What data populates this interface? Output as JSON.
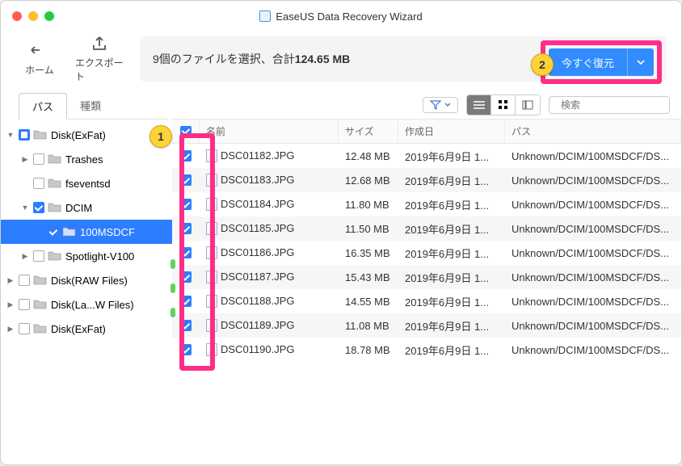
{
  "window_title": "EaseUS Data Recovery Wizard",
  "toolbar": {
    "home": "ホーム",
    "export": "エクスポート"
  },
  "summary": {
    "prefix": "9個のファイルを選択、合計",
    "size": "124.65 MB"
  },
  "restore_label": "今すぐ復元",
  "tabs": {
    "path": "パス",
    "kind": "種類"
  },
  "tree": [
    {
      "label": "Disk(ExFat)",
      "depth": 0,
      "expanded": true,
      "checked": "mix",
      "sel": false
    },
    {
      "label": "Trashes",
      "depth": 1,
      "expanded": false,
      "checked": "off",
      "sel": false
    },
    {
      "label": "fseventsd",
      "depth": 1,
      "expanded": null,
      "checked": "off",
      "sel": false
    },
    {
      "label": "DCIM",
      "depth": 1,
      "expanded": true,
      "checked": "on",
      "sel": false
    },
    {
      "label": "100MSDCF",
      "depth": 2,
      "expanded": null,
      "checked": "on",
      "sel": true
    },
    {
      "label": "Spotlight-V100",
      "depth": 1,
      "expanded": false,
      "checked": "off",
      "sel": false
    },
    {
      "label": "Disk(RAW Files)",
      "depth": 0,
      "expanded": false,
      "checked": "off",
      "sel": false
    },
    {
      "label": "Disk(La...W Files)",
      "depth": 0,
      "expanded": false,
      "checked": "off",
      "sel": false
    },
    {
      "label": "Disk(ExFat)",
      "depth": 0,
      "expanded": false,
      "checked": "off",
      "sel": false
    }
  ],
  "columns": {
    "name": "名前",
    "size": "サイズ",
    "date": "作成日",
    "path": "パス"
  },
  "search_placeholder": "検索",
  "callouts": {
    "one": "1",
    "two": "2"
  },
  "rows": [
    {
      "name": "DSC01182.JPG",
      "size": "12.48 MB",
      "date": "2019年6月9日 1...",
      "path": "Unknown/DCIM/100MSDCF/DS..."
    },
    {
      "name": "DSC01183.JPG",
      "size": "12.68 MB",
      "date": "2019年6月9日 1...",
      "path": "Unknown/DCIM/100MSDCF/DS..."
    },
    {
      "name": "DSC01184.JPG",
      "size": "11.80 MB",
      "date": "2019年6月9日 1...",
      "path": "Unknown/DCIM/100MSDCF/DS..."
    },
    {
      "name": "DSC01185.JPG",
      "size": "11.50 MB",
      "date": "2019年6月9日 1...",
      "path": "Unknown/DCIM/100MSDCF/DS..."
    },
    {
      "name": "DSC01186.JPG",
      "size": "16.35 MB",
      "date": "2019年6月9日 1...",
      "path": "Unknown/DCIM/100MSDCF/DS..."
    },
    {
      "name": "DSC01187.JPG",
      "size": "15.43 MB",
      "date": "2019年6月9日 1...",
      "path": "Unknown/DCIM/100MSDCF/DS..."
    },
    {
      "name": "DSC01188.JPG",
      "size": "14.55 MB",
      "date": "2019年6月9日 1...",
      "path": "Unknown/DCIM/100MSDCF/DS..."
    },
    {
      "name": "DSC01189.JPG",
      "size": "11.08 MB",
      "date": "2019年6月9日 1...",
      "path": "Unknown/DCIM/100MSDCF/DS..."
    },
    {
      "name": "DSC01190.JPG",
      "size": "18.78 MB",
      "date": "2019年6月9日 1...",
      "path": "Unknown/DCIM/100MSDCF/DS..."
    }
  ]
}
